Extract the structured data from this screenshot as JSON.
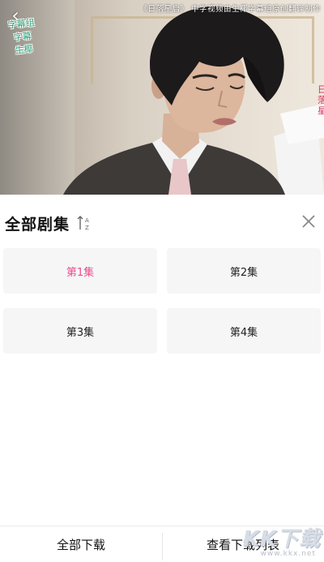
{
  "video": {
    "watermark_lines": [
      "字幕组",
      "字幕",
      "生椰"
    ],
    "subtitle_top": "《日落星启》 中字视频由生椰字幕组原创翻译制作",
    "side_text": "日落星"
  },
  "panel": {
    "title": "全部剧集",
    "sort_icon": "sort-az-icon",
    "close_icon": "close-icon",
    "episodes": [
      {
        "label": "第1集",
        "active": true
      },
      {
        "label": "第2集",
        "active": false
      },
      {
        "label": "第3集",
        "active": false
      },
      {
        "label": "第4集",
        "active": false
      }
    ],
    "active_color": "#ea4c8e"
  },
  "footer": {
    "download_all": "全部下载",
    "view_downloads": "查看下载列表"
  },
  "site_logo": {
    "text": "KK下载",
    "url": "www.kkx.net"
  }
}
